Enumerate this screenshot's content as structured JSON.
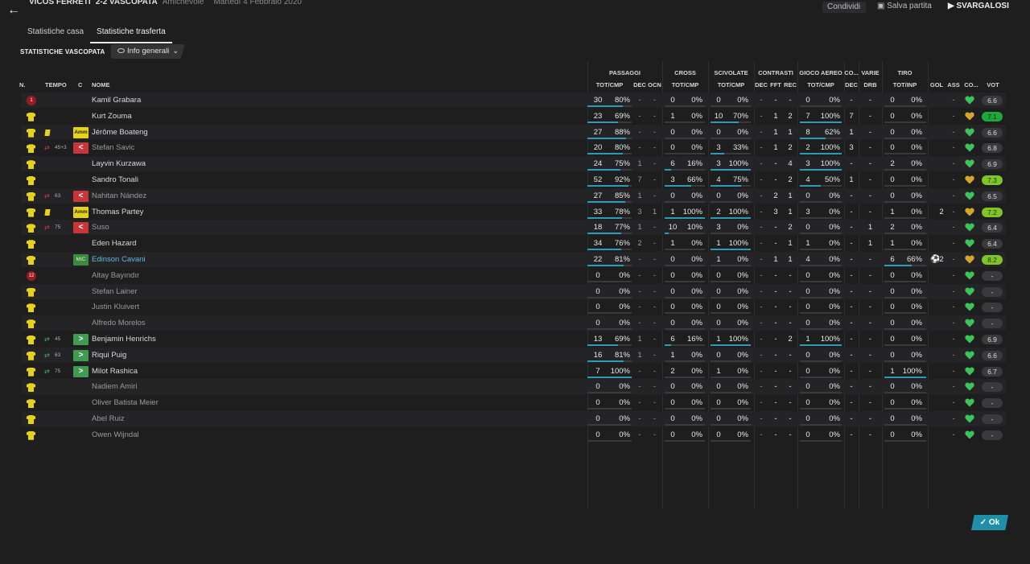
{
  "header": {
    "back_icon": "←",
    "teams": "VICOS FERRETI",
    "score": "2-2 VASCOPATA",
    "match_type": "Amichevole",
    "date": "Martedì 4 Febbraio 2020",
    "share": "Condividi",
    "save": "Salva partita",
    "end": "SVARGALOSI"
  },
  "tabs": [
    {
      "label": "Statistiche casa",
      "active": false
    },
    {
      "label": "Statistiche trasferta",
      "active": true
    }
  ],
  "section_title": "STATISTICHE VASCOPATA",
  "dropdown": {
    "label": "Info generali"
  },
  "groups": [
    "PASSAGGI",
    "CROSS",
    "SCIVOLATE",
    "CONTRASTI",
    "GIOCO AEREO",
    "CO...",
    "VARIE",
    "TIRO"
  ],
  "columns": {
    "n": "N.",
    "tempo": "TEMPO",
    "c": "C",
    "nome": "NOME",
    "pass_totcmp": "TOT/CMP",
    "pass_dec": "DEC",
    "pass_ocn": "OCN",
    "cross_totcmp": "TOT/CMP",
    "sciv_totcmp": "TOT/CMP",
    "con_dec": "DEC",
    "con_fft": "FFT",
    "con_rec": "REC",
    "aereo_totcmp": "TOT/CMP",
    "co_dec": "DEC",
    "varie_drb": "DRB",
    "tiro_totinp": "TOT/INP",
    "gol": "GOL",
    "ass": "ASS",
    "co": "CO...",
    "vot": "VOT"
  },
  "players": [
    {
      "num": "1",
      "gk": true,
      "tempo": "",
      "card": false,
      "sub": "",
      "pos": "",
      "name": "Kamil Grabara",
      "played": true,
      "p": [
        "30",
        "80%",
        "-",
        "-"
      ],
      "pbar": 0.8,
      "cr": [
        "0",
        "0%"
      ],
      "crbar": 0,
      "sc": [
        "0",
        "0%"
      ],
      "scbar": 0,
      "con": [
        "-",
        "-",
        "-"
      ],
      "ae": [
        "0",
        "0%"
      ],
      "aebar": 0,
      "co": "-",
      "drb": "-",
      "ti": [
        "0",
        "0%"
      ],
      "tibar": 0,
      "gol": "",
      "ass": "-",
      "vot": "6.6",
      "vclass": ""
    },
    {
      "num": "",
      "gk": false,
      "tempo": "",
      "card": false,
      "sub": "",
      "pos": "",
      "name": "Kurt Zouma",
      "played": true,
      "p": [
        "23",
        "69%",
        "-",
        "-"
      ],
      "pbar": 0.69,
      "cr": [
        "1",
        "0%"
      ],
      "crbar": 0,
      "sc": [
        "10",
        "70%"
      ],
      "scbar": 0.7,
      "con": [
        "-",
        "1",
        "2"
      ],
      "ae": [
        "7",
        "100%"
      ],
      "aebar": 1,
      "co": "7",
      "drb": "-",
      "ti": [
        "0",
        "0%"
      ],
      "tibar": 0,
      "gol": "",
      "ass": "-",
      "vot": "7.1",
      "vclass": "excellent"
    },
    {
      "num": "",
      "gk": false,
      "tempo": "",
      "card": true,
      "sub": "",
      "pos": "Amm",
      "name": "Jérôme Boateng",
      "played": true,
      "p": [
        "27",
        "88%",
        "-",
        "-"
      ],
      "pbar": 0.88,
      "cr": [
        "0",
        "0%"
      ],
      "crbar": 0,
      "sc": [
        "0",
        "0%"
      ],
      "scbar": 0,
      "con": [
        "-",
        "1",
        "1"
      ],
      "ae": [
        "8",
        "62%"
      ],
      "aebar": 0.62,
      "co": "1",
      "drb": "-",
      "ti": [
        "0",
        "0%"
      ],
      "tibar": 0,
      "gol": "",
      "ass": "-",
      "vot": "6.6",
      "vclass": ""
    },
    {
      "num": "",
      "gk": false,
      "tempo": "45+3",
      "card": false,
      "sub": "out",
      "pos": "<",
      "name": "Stefan Savic",
      "played": false,
      "p": [
        "20",
        "80%",
        "-",
        "-"
      ],
      "pbar": 0.8,
      "cr": [
        "0",
        "0%"
      ],
      "crbar": 0,
      "sc": [
        "3",
        "33%"
      ],
      "scbar": 0.33,
      "con": [
        "-",
        "1",
        "2"
      ],
      "ae": [
        "2",
        "100%"
      ],
      "aebar": 1,
      "co": "3",
      "drb": "-",
      "ti": [
        "0",
        "0%"
      ],
      "tibar": 0,
      "gol": "",
      "ass": "-",
      "vot": "6.8",
      "vclass": ""
    },
    {
      "num": "",
      "gk": false,
      "tempo": "",
      "card": false,
      "sub": "",
      "pos": "",
      "name": "Layvin Kurzawa",
      "played": true,
      "p": [
        "24",
        "75%",
        "1",
        "-"
      ],
      "pbar": 0.75,
      "cr": [
        "6",
        "16%"
      ],
      "crbar": 0.16,
      "sc": [
        "3",
        "100%"
      ],
      "scbar": 1,
      "con": [
        "-",
        "-",
        "4"
      ],
      "ae": [
        "3",
        "100%"
      ],
      "aebar": 1,
      "co": "-",
      "drb": "-",
      "ti": [
        "2",
        "0%"
      ],
      "tibar": 0,
      "gol": "",
      "ass": "-",
      "vot": "6.9",
      "vclass": ""
    },
    {
      "num": "",
      "gk": false,
      "tempo": "",
      "card": false,
      "sub": "",
      "pos": "",
      "name": "Sandro Tonali",
      "played": true,
      "p": [
        "52",
        "92%",
        "7",
        "-"
      ],
      "pbar": 0.92,
      "cr": [
        "3",
        "66%"
      ],
      "crbar": 0.66,
      "sc": [
        "4",
        "75%"
      ],
      "scbar": 0.75,
      "con": [
        "-",
        "-",
        "2"
      ],
      "ae": [
        "4",
        "50%"
      ],
      "aebar": 0.5,
      "co": "1",
      "drb": "-",
      "ti": [
        "0",
        "0%"
      ],
      "tibar": 0,
      "gol": "",
      "ass": "-",
      "vot": "7.3",
      "vclass": "good"
    },
    {
      "num": "",
      "gk": false,
      "tempo": "63",
      "card": false,
      "sub": "out",
      "pos": "<",
      "name": "Nahitan Nández",
      "played": false,
      "p": [
        "27",
        "85%",
        "1",
        "-"
      ],
      "pbar": 0.85,
      "cr": [
        "0",
        "0%"
      ],
      "crbar": 0,
      "sc": [
        "0",
        "0%"
      ],
      "scbar": 0,
      "con": [
        "-",
        "2",
        "1"
      ],
      "ae": [
        "0",
        "0%"
      ],
      "aebar": 0,
      "co": "-",
      "drb": "-",
      "ti": [
        "0",
        "0%"
      ],
      "tibar": 0,
      "gol": "",
      "ass": "-",
      "vot": "6.5",
      "vclass": ""
    },
    {
      "num": "",
      "gk": false,
      "tempo": "",
      "card": true,
      "sub": "",
      "pos": "Amm",
      "name": "Thomas Partey",
      "played": true,
      "p": [
        "33",
        "78%",
        "3",
        "1"
      ],
      "pbar": 0.78,
      "cr": [
        "1",
        "100%"
      ],
      "crbar": 1,
      "sc": [
        "2",
        "100%"
      ],
      "scbar": 1,
      "con": [
        "-",
        "3",
        "1"
      ],
      "ae": [
        "3",
        "0%"
      ],
      "aebar": 0,
      "co": "-",
      "drb": "-",
      "ti": [
        "1",
        "0%"
      ],
      "tibar": 0,
      "gol": "2",
      "ass": "-",
      "vot": "7.2",
      "vclass": "good"
    },
    {
      "num": "",
      "gk": false,
      "tempo": "75",
      "card": false,
      "sub": "out",
      "pos": "<",
      "name": "Suso",
      "played": false,
      "p": [
        "18",
        "77%",
        "1",
        "-"
      ],
      "pbar": 0.77,
      "cr": [
        "10",
        "10%"
      ],
      "crbar": 0.1,
      "sc": [
        "3",
        "0%"
      ],
      "scbar": 0,
      "con": [
        "-",
        "-",
        "2"
      ],
      "ae": [
        "0",
        "0%"
      ],
      "aebar": 0,
      "co": "-",
      "drb": "1",
      "ti": [
        "2",
        "0%"
      ],
      "tibar": 0,
      "gol": "",
      "ass": "-",
      "vot": "6.4",
      "vclass": ""
    },
    {
      "num": "",
      "gk": false,
      "tempo": "",
      "card": false,
      "sub": "",
      "pos": "",
      "name": "Eden Hazard",
      "played": true,
      "p": [
        "34",
        "76%",
        "2",
        "-"
      ],
      "pbar": 0.76,
      "cr": [
        "1",
        "0%"
      ],
      "crbar": 0,
      "sc": [
        "1",
        "100%"
      ],
      "scbar": 1,
      "con": [
        "-",
        "-",
        "1"
      ],
      "ae": [
        "1",
        "0%"
      ],
      "aebar": 0,
      "co": "-",
      "drb": "1",
      "ti": [
        "1",
        "0%"
      ],
      "tibar": 0,
      "gol": "",
      "ass": "-",
      "vot": "6.4",
      "vclass": ""
    },
    {
      "num": "",
      "gk": false,
      "tempo": "",
      "card": false,
      "sub": "",
      "pos": "MIC",
      "name": "Edinson Cavani",
      "played": true,
      "highlight": true,
      "p": [
        "22",
        "81%",
        "-",
        "-"
      ],
      "pbar": 0.81,
      "cr": [
        "0",
        "0%"
      ],
      "crbar": 0,
      "sc": [
        "1",
        "0%"
      ],
      "scbar": 0,
      "con": [
        "-",
        "1",
        "1"
      ],
      "ae": [
        "4",
        "0%"
      ],
      "aebar": 0,
      "co": "-",
      "drb": "-",
      "ti": [
        "6",
        "66%"
      ],
      "tibar": 0.66,
      "gol": "2",
      "gear": true,
      "ass": "-",
      "vot": "8.2",
      "vclass": "good"
    },
    {
      "num": "12",
      "gk": true,
      "tempo": "",
      "card": false,
      "sub": "",
      "pos": "",
      "name": "Altay Bayındır",
      "played": false,
      "p": [
        "0",
        "0%",
        "-",
        "-"
      ],
      "pbar": 0,
      "cr": [
        "0",
        "0%"
      ],
      "crbar": 0,
      "sc": [
        "0",
        "0%"
      ],
      "scbar": 0,
      "con": [
        "-",
        "-",
        "-"
      ],
      "ae": [
        "0",
        "0%"
      ],
      "aebar": 0,
      "co": "-",
      "drb": "-",
      "ti": [
        "0",
        "0%"
      ],
      "tibar": 0,
      "gol": "",
      "ass": "-",
      "vot": "-",
      "vclass": ""
    },
    {
      "num": "",
      "gk": false,
      "tempo": "",
      "card": false,
      "sub": "",
      "pos": "",
      "name": "Stefan Lainer",
      "played": false,
      "p": [
        "0",
        "0%",
        "-",
        "-"
      ],
      "pbar": 0,
      "cr": [
        "0",
        "0%"
      ],
      "crbar": 0,
      "sc": [
        "0",
        "0%"
      ],
      "scbar": 0,
      "con": [
        "-",
        "-",
        "-"
      ],
      "ae": [
        "0",
        "0%"
      ],
      "aebar": 0,
      "co": "-",
      "drb": "-",
      "ti": [
        "0",
        "0%"
      ],
      "tibar": 0,
      "gol": "",
      "ass": "-",
      "vot": "-",
      "vclass": ""
    },
    {
      "num": "",
      "gk": false,
      "tempo": "",
      "card": false,
      "sub": "",
      "pos": "",
      "name": "Justin Kluivert",
      "played": false,
      "p": [
        "0",
        "0%",
        "-",
        "-"
      ],
      "pbar": 0,
      "cr": [
        "0",
        "0%"
      ],
      "crbar": 0,
      "sc": [
        "0",
        "0%"
      ],
      "scbar": 0,
      "con": [
        "-",
        "-",
        "-"
      ],
      "ae": [
        "0",
        "0%"
      ],
      "aebar": 0,
      "co": "-",
      "drb": "-",
      "ti": [
        "0",
        "0%"
      ],
      "tibar": 0,
      "gol": "",
      "ass": "-",
      "vot": "-",
      "vclass": ""
    },
    {
      "num": "",
      "gk": false,
      "tempo": "",
      "card": false,
      "sub": "",
      "pos": "",
      "name": "Alfredo Morelos",
      "played": false,
      "p": [
        "0",
        "0%",
        "-",
        "-"
      ],
      "pbar": 0,
      "cr": [
        "0",
        "0%"
      ],
      "crbar": 0,
      "sc": [
        "0",
        "0%"
      ],
      "scbar": 0,
      "con": [
        "-",
        "-",
        "-"
      ],
      "ae": [
        "0",
        "0%"
      ],
      "aebar": 0,
      "co": "-",
      "drb": "-",
      "ti": [
        "0",
        "0%"
      ],
      "tibar": 0,
      "gol": "",
      "ass": "-",
      "vot": "-",
      "vclass": ""
    },
    {
      "num": "",
      "gk": false,
      "tempo": "45",
      "card": false,
      "sub": "in",
      "pos": ">",
      "name": "Benjamin Henrichs",
      "played": true,
      "p": [
        "13",
        "69%",
        "1",
        "-"
      ],
      "pbar": 0.69,
      "cr": [
        "6",
        "16%"
      ],
      "crbar": 0.16,
      "sc": [
        "1",
        "100%"
      ],
      "scbar": 1,
      "con": [
        "-",
        "-",
        "2"
      ],
      "ae": [
        "1",
        "100%"
      ],
      "aebar": 1,
      "co": "-",
      "drb": "-",
      "ti": [
        "0",
        "0%"
      ],
      "tibar": 0,
      "gol": "",
      "ass": "-",
      "vot": "6.9",
      "vclass": ""
    },
    {
      "num": "",
      "gk": false,
      "tempo": "63",
      "card": false,
      "sub": "in",
      "pos": ">",
      "name": "Riqui Puig",
      "played": true,
      "p": [
        "16",
        "81%",
        "1",
        "-"
      ],
      "pbar": 0.81,
      "cr": [
        "1",
        "0%"
      ],
      "crbar": 0,
      "sc": [
        "0",
        "0%"
      ],
      "scbar": 0,
      "con": [
        "-",
        "-",
        "-"
      ],
      "ae": [
        "0",
        "0%"
      ],
      "aebar": 0,
      "co": "-",
      "drb": "-",
      "ti": [
        "0",
        "0%"
      ],
      "tibar": 0,
      "gol": "",
      "ass": "-",
      "vot": "6.6",
      "vclass": ""
    },
    {
      "num": "",
      "gk": false,
      "tempo": "75",
      "card": false,
      "sub": "in",
      "pos": ">",
      "name": "Milot Rashica",
      "played": true,
      "p": [
        "7",
        "100%",
        "-",
        "-"
      ],
      "pbar": 1,
      "cr": [
        "2",
        "0%"
      ],
      "crbar": 0,
      "sc": [
        "1",
        "0%"
      ],
      "scbar": 0,
      "con": [
        "-",
        "-",
        "-"
      ],
      "ae": [
        "0",
        "0%"
      ],
      "aebar": 0,
      "co": "-",
      "drb": "-",
      "ti": [
        "1",
        "100%"
      ],
      "tibar": 1,
      "gol": "",
      "ass": "-",
      "vot": "6.7",
      "vclass": ""
    },
    {
      "num": "",
      "gk": false,
      "tempo": "",
      "card": false,
      "sub": "",
      "pos": "",
      "name": "Nadiem Amiri",
      "played": false,
      "p": [
        "0",
        "0%",
        "-",
        "-"
      ],
      "pbar": 0,
      "cr": [
        "0",
        "0%"
      ],
      "crbar": 0,
      "sc": [
        "0",
        "0%"
      ],
      "scbar": 0,
      "con": [
        "-",
        "-",
        "-"
      ],
      "ae": [
        "0",
        "0%"
      ],
      "aebar": 0,
      "co": "-",
      "drb": "-",
      "ti": [
        "0",
        "0%"
      ],
      "tibar": 0,
      "gol": "",
      "ass": "-",
      "vot": "-",
      "vclass": ""
    },
    {
      "num": "",
      "gk": false,
      "tempo": "",
      "card": false,
      "sub": "",
      "pos": "",
      "name": "Oliver Batista Meier",
      "played": false,
      "p": [
        "0",
        "0%",
        "-",
        "-"
      ],
      "pbar": 0,
      "cr": [
        "0",
        "0%"
      ],
      "crbar": 0,
      "sc": [
        "0",
        "0%"
      ],
      "scbar": 0,
      "con": [
        "-",
        "-",
        "-"
      ],
      "ae": [
        "0",
        "0%"
      ],
      "aebar": 0,
      "co": "-",
      "drb": "-",
      "ti": [
        "0",
        "0%"
      ],
      "tibar": 0,
      "gol": "",
      "ass": "-",
      "vot": "-",
      "vclass": ""
    },
    {
      "num": "",
      "gk": false,
      "tempo": "",
      "card": false,
      "sub": "",
      "pos": "",
      "name": "Abel Ruiz",
      "played": false,
      "p": [
        "0",
        "0%",
        "-",
        "-"
      ],
      "pbar": 0,
      "cr": [
        "0",
        "0%"
      ],
      "crbar": 0,
      "sc": [
        "0",
        "0%"
      ],
      "scbar": 0,
      "con": [
        "-",
        "-",
        "-"
      ],
      "ae": [
        "0",
        "0%"
      ],
      "aebar": 0,
      "co": "-",
      "drb": "-",
      "ti": [
        "0",
        "0%"
      ],
      "tibar": 0,
      "gol": "",
      "ass": "-",
      "vot": "-",
      "vclass": ""
    },
    {
      "num": "",
      "gk": false,
      "tempo": "",
      "card": false,
      "sub": "",
      "pos": "",
      "name": "Owen Wijndal",
      "played": false,
      "p": [
        "0",
        "0%",
        "-",
        "-"
      ],
      "pbar": 0,
      "cr": [
        "0",
        "0%"
      ],
      "crbar": 0,
      "sc": [
        "0",
        "0%"
      ],
      "scbar": 0,
      "con": [
        "-",
        "-",
        "-"
      ],
      "ae": [
        "0",
        "0%"
      ],
      "aebar": 0,
      "co": "-",
      "drb": "-",
      "ti": [
        "0",
        "0%"
      ],
      "tibar": 0,
      "gol": "",
      "ass": "-",
      "vot": "-",
      "vclass": ""
    }
  ],
  "ok_button": "Ok",
  "colors": {
    "accent": "#2b9bb8",
    "card": "#e6d21a",
    "sub_off": "#c9363a",
    "sub_on": "#3f9a52",
    "rating_good": "#7ec42a",
    "rating_excellent": "#1ea83a"
  }
}
